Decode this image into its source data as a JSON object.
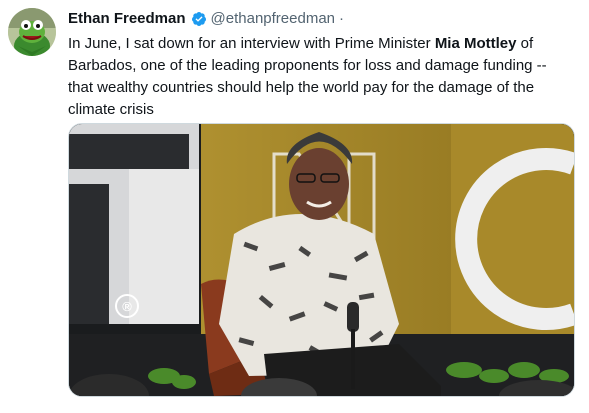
{
  "tweet": {
    "author": {
      "display_name": "Ethan Freedman",
      "handle": "@ethanpfreedman",
      "verified": true,
      "avatar_icon": "kermit-frog-avatar"
    },
    "separator": "·",
    "text_parts": {
      "before_bold": "In June, I sat down for an interview with Prime Minister ",
      "bold": "Mia Mottley",
      "after_bold": " of Barbados, one of the leading proponents for loss and damage funding -- that wealthy countries should help the world pay for the damage of the climate crisis"
    },
    "media": {
      "stage_letters": "NC",
      "registered_mark": "®"
    }
  },
  "colors": {
    "verified_blue": "#1d9bf0",
    "text_primary": "#0f1419",
    "text_secondary": "#536471",
    "backdrop_gold": "#a8892a"
  }
}
